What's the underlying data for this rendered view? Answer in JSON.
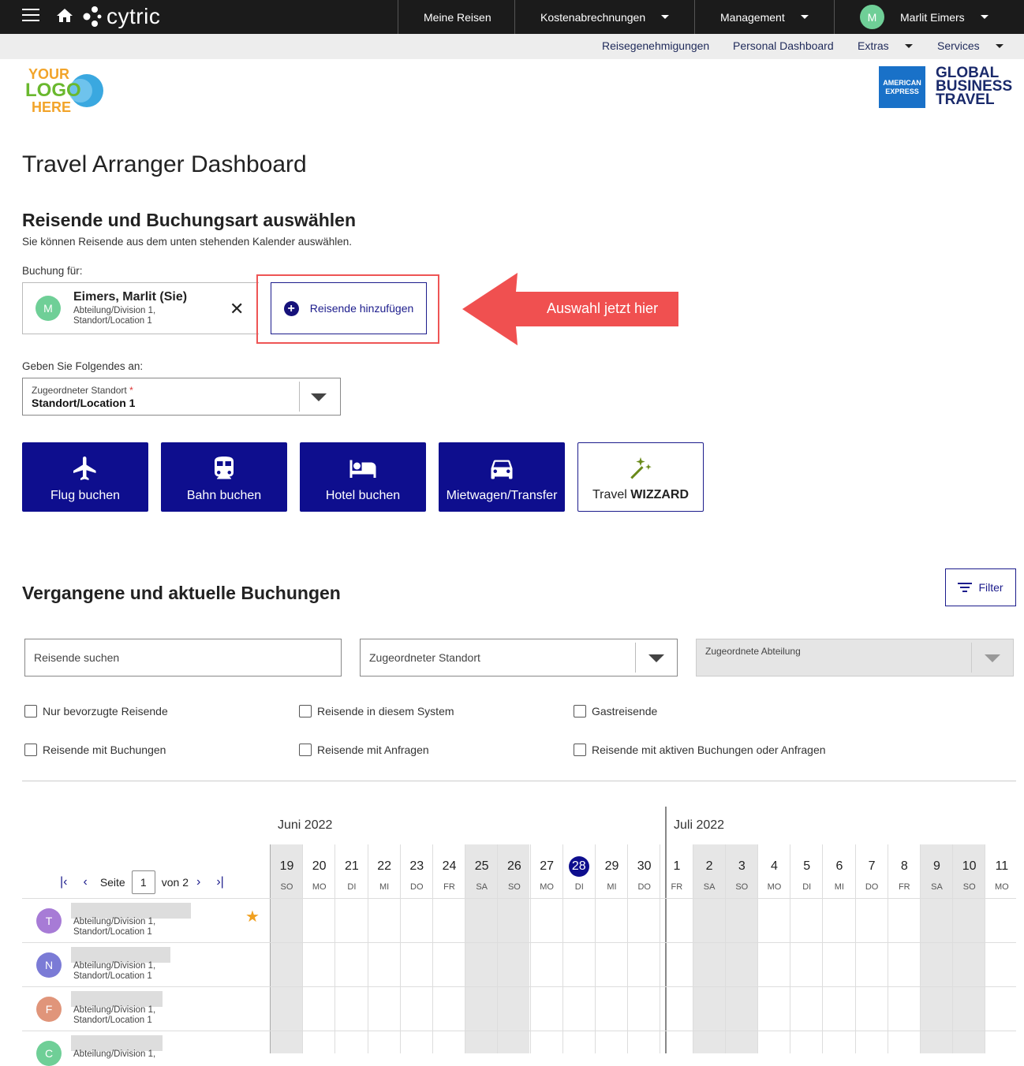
{
  "topbar": {
    "brand": "cytric",
    "nav": [
      {
        "label": "Meine Reisen"
      },
      {
        "label": "Kostenabrechnungen"
      },
      {
        "label": "Management"
      },
      {
        "label": "Marlit Eimers",
        "avatar": "M"
      }
    ]
  },
  "subbar": {
    "items": [
      {
        "label": "Reisegenehmigungen"
      },
      {
        "label": "Personal Dashboard"
      },
      {
        "label": "Extras"
      },
      {
        "label": "Services"
      }
    ]
  },
  "logos": {
    "left": [
      "YOUR",
      "LOGO",
      "HERE"
    ],
    "amex": [
      "AMERICAN",
      "EXPRESS"
    ],
    "gbt": [
      "GLOBAL",
      "BUSINESS",
      "TRAVEL"
    ]
  },
  "page": {
    "title": "Travel Arranger Dashboard",
    "section1": {
      "title": "Reisende und Buchungsart auswählen",
      "subtitle": "Sie können Reisende aus dem unten stehenden Kalender auswählen.",
      "booking_for": "Buchung für:",
      "traveler": {
        "avatar": "M",
        "name": "Eimers, Marlit (Sie)",
        "line1": "Abteilung/Division 1,",
        "line2": "Standort/Location 1"
      },
      "add_button": "Reisende hinzufügen",
      "annotation": "Auswahl jetzt hier",
      "enter_label": "Geben Sie Folgendes an:",
      "location_select": {
        "label": "Zugeordneter Standort",
        "required": "*",
        "value": "Standort/Location 1"
      },
      "tiles": [
        {
          "label": "Flug buchen",
          "icon": "plane-icon"
        },
        {
          "label": "Bahn buchen",
          "icon": "train-icon"
        },
        {
          "label": "Hotel buchen",
          "icon": "bed-icon"
        },
        {
          "label": "Mietwagen/Transfer",
          "icon": "car-icon"
        }
      ],
      "wizard": {
        "prefix": "Travel ",
        "bold": "WIZZARD"
      }
    },
    "section2": {
      "title": "Vergangene und aktuelle Buchungen",
      "filter_button": "Filter",
      "search_placeholder": "Reisende suchen",
      "location_placeholder": "Zugeordneter Standort",
      "department_placeholder": "Zugeordnete Abteilung",
      "checkboxes": [
        "Nur bevorzugte Reisende",
        "Reisende in diesem System",
        "Gastreisende",
        "Reisende mit Buchungen",
        "Reisende mit Anfragen",
        "Reisende mit aktiven Buchungen oder Anfragen"
      ]
    },
    "calendar": {
      "months": [
        "Juni 2022",
        "Juli 2022"
      ],
      "pager": {
        "label": "Seite",
        "page": "1",
        "of": "von 2"
      },
      "days": [
        {
          "n": "19",
          "d": "SO",
          "we": true
        },
        {
          "n": "20",
          "d": "MO"
        },
        {
          "n": "21",
          "d": "DI"
        },
        {
          "n": "22",
          "d": "MI"
        },
        {
          "n": "23",
          "d": "DO"
        },
        {
          "n": "24",
          "d": "FR"
        },
        {
          "n": "25",
          "d": "SA",
          "we": true
        },
        {
          "n": "26",
          "d": "SO",
          "we": true
        },
        {
          "n": "27",
          "d": "MO"
        },
        {
          "n": "28",
          "d": "DI",
          "today": true
        },
        {
          "n": "29",
          "d": "MI"
        },
        {
          "n": "30",
          "d": "DO"
        },
        {
          "n": "1",
          "d": "FR"
        },
        {
          "n": "2",
          "d": "SA",
          "we": true
        },
        {
          "n": "3",
          "d": "SO",
          "we": true
        },
        {
          "n": "4",
          "d": "MO"
        },
        {
          "n": "5",
          "d": "DI"
        },
        {
          "n": "6",
          "d": "MI"
        },
        {
          "n": "7",
          "d": "DO"
        },
        {
          "n": "8",
          "d": "FR"
        },
        {
          "n": "9",
          "d": "SA",
          "we": true
        },
        {
          "n": "10",
          "d": "SO",
          "we": true
        },
        {
          "n": "11",
          "d": "MO"
        }
      ],
      "rows": [
        {
          "avatar": "T",
          "color": "#a77bd6",
          "line1": "Abteilung/Division 1,",
          "line2": "Standort/Location 1",
          "favorite": true
        },
        {
          "avatar": "N",
          "color": "#7b7bd6",
          "line1": "Abteilung/Division 1,",
          "line2": "Standort/Location 1"
        },
        {
          "avatar": "F",
          "color": "#e0957a",
          "line1": "Abteilung/Division 1,",
          "line2": "Standort/Location 1"
        },
        {
          "avatar": "C",
          "color": "#6fcf97",
          "line1": "Abteilung/Division 1,",
          "line2": ""
        }
      ]
    }
  }
}
